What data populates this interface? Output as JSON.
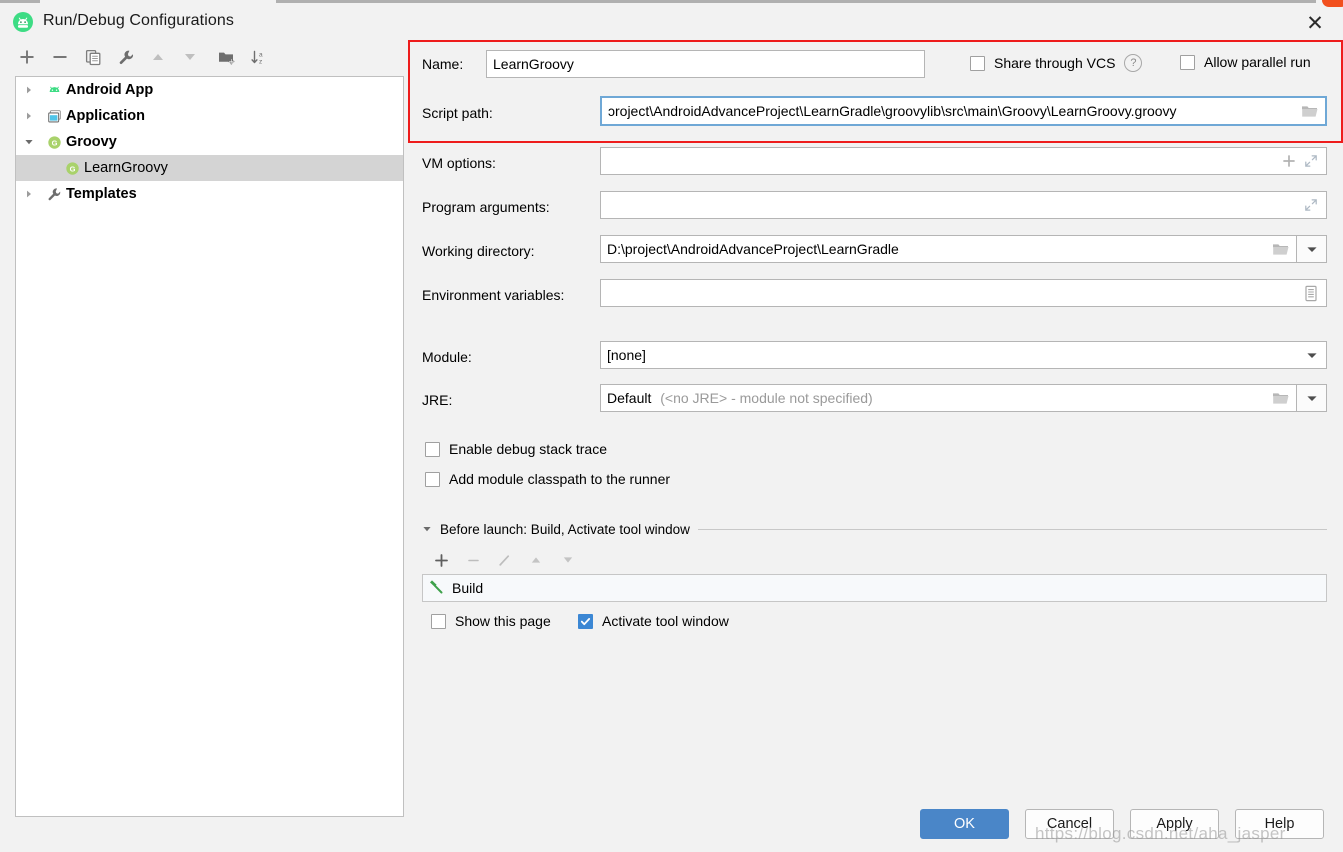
{
  "window": {
    "title": "Run/Debug Configurations",
    "app_icon": "android-studio-icon",
    "close_label": "✕"
  },
  "left_panel": {
    "toolbar": [
      {
        "name": "add-configuration-button",
        "icon": "plus-icon",
        "tooltip": "Add New Configuration"
      },
      {
        "name": "remove-configuration-button",
        "icon": "minus-icon",
        "tooltip": "Remove Configuration"
      },
      {
        "name": "copy-configuration-button",
        "icon": "copy-icon",
        "tooltip": "Copy Configuration"
      },
      {
        "name": "edit-defaults-button",
        "icon": "wrench-icon",
        "tooltip": "Edit defaults"
      },
      {
        "name": "move-up-button",
        "icon": "arrow-up-icon",
        "tooltip": "Move Up"
      },
      {
        "name": "move-down-button",
        "icon": "arrow-down-icon",
        "tooltip": "Move Down"
      },
      {
        "name": "create-folder-button",
        "icon": "folder-add-icon",
        "tooltip": "Create New Folder"
      },
      {
        "name": "sort-configurations-button",
        "icon": "sort-az-icon",
        "tooltip": "Sort Configurations"
      }
    ],
    "tree": [
      {
        "label": "Android App",
        "icon": "android-icon",
        "expander": "collapsed",
        "indent": 0,
        "bold": true,
        "selected": false
      },
      {
        "label": "Application",
        "icon": "window-icon",
        "expander": "collapsed",
        "indent": 0,
        "bold": true,
        "selected": false
      },
      {
        "label": "Groovy",
        "icon": "groovy-icon",
        "expander": "expanded",
        "indent": 0,
        "bold": true,
        "selected": false
      },
      {
        "label": "LearnGroovy",
        "icon": "groovy-icon",
        "expander": "none",
        "indent": 1,
        "bold": false,
        "selected": true
      },
      {
        "label": "Templates",
        "icon": "wrench-icon",
        "expander": "collapsed",
        "indent": 0,
        "bold": true,
        "selected": false
      }
    ]
  },
  "form": {
    "name": {
      "label": "Name:",
      "value": "LearnGroovy"
    },
    "share_through_vcs": {
      "label": "Share through VCS",
      "checked": false,
      "help_glyph": "?"
    },
    "allow_parallel_run": {
      "label": "Allow parallel run",
      "checked": false
    },
    "script_path": {
      "label": "Script path:",
      "value": "ɔroject\\AndroidAdvanceProject\\LearnGradle\\groovylib\\src\\main\\Groovy\\LearnGroovy.groovy",
      "browse_icon": "folder-icon"
    },
    "vm_options": {
      "label": "VM options:",
      "value": "",
      "icons": [
        "plus-icon",
        "expand-icon"
      ]
    },
    "program_arguments": {
      "label": "Program arguments:",
      "value": "",
      "icons": [
        "expand-icon"
      ]
    },
    "working_directory": {
      "label": "Working directory:",
      "value": "D:\\project\\AndroidAdvanceProject\\LearnGradle",
      "browse_icon": "folder-icon",
      "dropdown_icon": "chevron-down-icon"
    },
    "environment_variables": {
      "label": "Environment variables:",
      "value": "",
      "icons": [
        "list-edit-icon"
      ]
    },
    "module": {
      "label": "Module:",
      "value": "[none]",
      "dropdown_icon": "chevron-down-icon"
    },
    "jre": {
      "label": "JRE:",
      "value": "Default",
      "value_hint": "(<no JRE> - module not specified)",
      "browse_icon": "folder-icon",
      "dropdown_icon": "chevron-down-icon"
    },
    "enable_debug_stack_trace": {
      "label": "Enable debug stack trace",
      "checked": false
    },
    "add_module_classpath": {
      "label": "Add module classpath to the runner",
      "checked": false
    }
  },
  "before_launch": {
    "header": "Before launch: Build, Activate tool window",
    "expander": "expanded",
    "toolbar": [
      {
        "name": "before-launch-add-button",
        "icon": "plus-icon",
        "enabled": true
      },
      {
        "name": "before-launch-remove-button",
        "icon": "minus-icon",
        "enabled": false
      },
      {
        "name": "before-launch-edit-button",
        "icon": "pencil-icon",
        "enabled": false
      },
      {
        "name": "before-launch-up-button",
        "icon": "arrow-up-icon",
        "enabled": false
      },
      {
        "name": "before-launch-down-button",
        "icon": "arrow-down-icon",
        "enabled": false
      }
    ],
    "tasks": [
      {
        "label": "Build",
        "icon": "build-hammer-icon"
      }
    ],
    "show_this_page": {
      "label": "Show this page",
      "checked": false
    },
    "activate_tool_window": {
      "label": "Activate tool window",
      "checked": true
    }
  },
  "footer": {
    "buttons": [
      {
        "name": "ok-button",
        "label": "OK",
        "primary": true
      },
      {
        "name": "cancel-button",
        "label": "Cancel",
        "primary": false
      },
      {
        "name": "apply-button",
        "label": "Apply",
        "primary": false
      },
      {
        "name": "help-button",
        "label": "Help",
        "primary": false
      }
    ]
  },
  "watermark": {
    "text": "https://blog.csdn.net/aha_jasper"
  },
  "colors": {
    "dialog_bg": "#f2f2f2",
    "accent_blue": "#4a86c8",
    "checkbox_checked": "#3b87d4",
    "annotation_red": "#ee1c1c",
    "tree_selection": "#d4d4d4",
    "groovy_green": "#8cc152",
    "android_green": "#3ddc84"
  }
}
